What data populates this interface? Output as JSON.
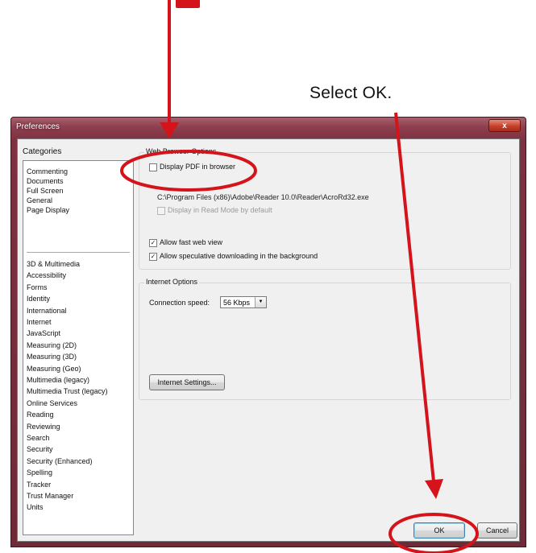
{
  "annotation": {
    "caption": "Select OK.",
    "arrow_color": "#d4141a"
  },
  "dialog": {
    "title": "Preferences",
    "close_label": "x",
    "categories_label": "Categories",
    "categories_group1": [
      "Commenting",
      "Documents",
      "Full Screen",
      "General",
      "Page Display"
    ],
    "categories_group2": [
      "3D & Multimedia",
      "Accessibility",
      "Forms",
      "Identity",
      "International",
      "Internet",
      "JavaScript",
      "Measuring (2D)",
      "Measuring (3D)",
      "Measuring (Geo)",
      "Multimedia (legacy)",
      "Multimedia Trust (legacy)",
      "Online Services",
      "Reading",
      "Reviewing",
      "Search",
      "Security",
      "Security (Enhanced)",
      "Spelling",
      "Tracker",
      "Trust Manager",
      "Units"
    ]
  },
  "web_browser": {
    "group_label": "Web Browser Options",
    "display_pdf": {
      "label": "Display PDF in browser",
      "checked": false
    },
    "reader_path": "C:\\Program Files (x86)\\Adobe\\Reader 10.0\\Reader\\AcroRd32.exe",
    "read_mode": {
      "label": "Display in Read Mode by default",
      "checked": false,
      "enabled": false
    },
    "fast_web_view": {
      "label": "Allow fast web view",
      "checked": true
    },
    "speculative": {
      "label": "Allow speculative downloading in the background",
      "checked": true
    }
  },
  "internet": {
    "group_label": "Internet Options",
    "speed_label": "Connection speed:",
    "speed_value": "56 Kbps",
    "settings_button": "Internet Settings..."
  },
  "footer": {
    "ok_label": "OK",
    "cancel_label": "Cancel"
  }
}
